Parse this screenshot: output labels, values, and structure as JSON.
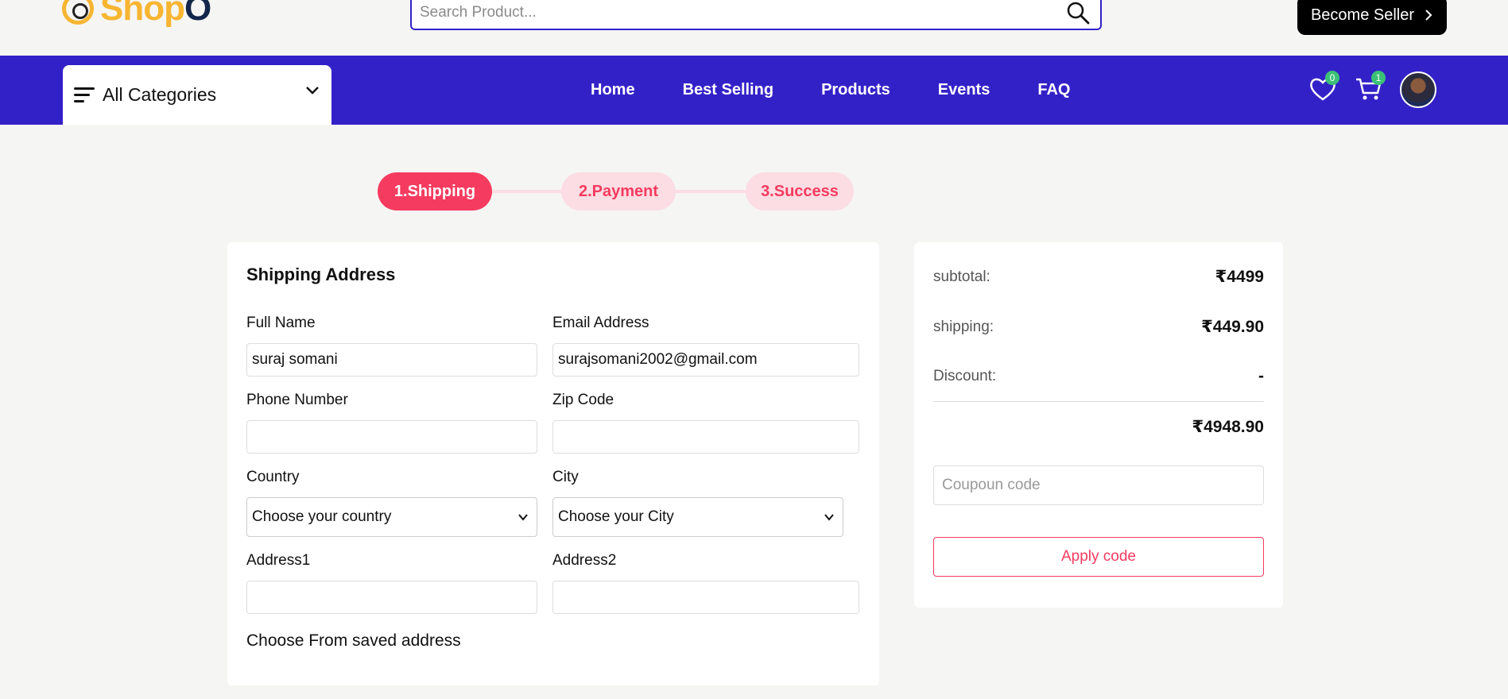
{
  "header": {
    "logo_part1": "Shop",
    "logo_part2": "O",
    "search_placeholder": "Search Product...",
    "become_seller_label": "Become Seller",
    "brand_color": "#f7b531",
    "accent_color": "#3321c8"
  },
  "nav": {
    "categories_label": "All Categories",
    "links": [
      "Home",
      "Best Selling",
      "Products",
      "Events",
      "FAQ"
    ],
    "wishlist_count": "0",
    "cart_count": "1"
  },
  "steps": {
    "items": [
      "1.Shipping",
      "2.Payment",
      "3.Success"
    ],
    "active_color": "#f63b60"
  },
  "shipping": {
    "title": "Shipping Address",
    "full_name_label": "Full Name",
    "full_name_value": "suraj somani",
    "email_label": "Email Address",
    "email_value": "surajsomani2002@gmail.com",
    "phone_label": "Phone Number",
    "phone_value": "",
    "zip_label": "Zip Code",
    "zip_value": "",
    "country_label": "Country",
    "country_selected": "Choose your country",
    "city_label": "City",
    "city_selected": "Choose your City",
    "address1_label": "Address1",
    "address1_value": "",
    "address2_label": "Address2",
    "address2_value": "",
    "saved_address_label": "Choose From saved address"
  },
  "summary": {
    "subtotal_label": "subtotal:",
    "subtotal_value": "₹4499",
    "shipping_label": "shipping:",
    "shipping_value": "₹449.90",
    "discount_label": "Discount:",
    "discount_value": "-",
    "total_value": "₹4948.90",
    "coupon_placeholder": "Coupoun code",
    "apply_label": "Apply code"
  }
}
